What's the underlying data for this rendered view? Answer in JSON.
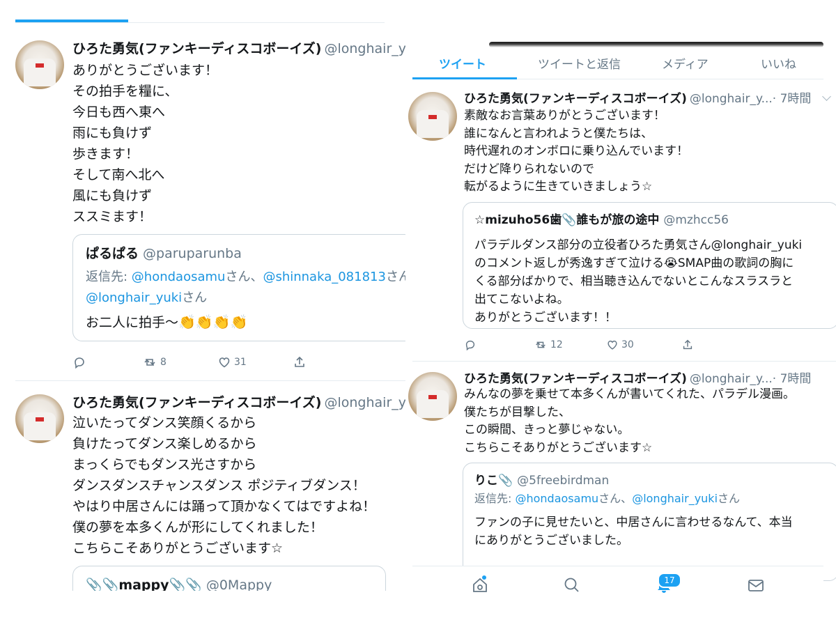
{
  "left": {
    "tweet1": {
      "name": "ひろた勇気(ファンキーディスコボーイズ)",
      "handle": "@longhair_y...",
      "lines": [
        "ありがとうございます！",
        "その拍手を糧に、",
        "今日も西へ東へ",
        "雨にも負けず",
        "歩きます！",
        "そして南へ北へ",
        "風にも負けず",
        "ススミます！"
      ],
      "quote": {
        "name": "ぱるぱる",
        "handle": "@paruparunba",
        "reply_prefix": "返信先: ",
        "reply_mention1": "@hondaosamu",
        "reply_mid1": "さん、",
        "reply_mention2": "@shinnaka_081813",
        "reply_mid2": "さん、",
        "reply_mention3": "@longhair_yuki",
        "reply_suffix": "さん",
        "text": "お二人に拍手〜",
        "claps": "👏👏👏👏"
      },
      "retweets": "8",
      "likes": "31"
    },
    "tweet2": {
      "name": "ひろた勇気(ファンキーディスコボーイズ)",
      "handle": "@longhair_y...",
      "lines": [
        "泣いたってダンス笑顔くるから",
        "負けたってダンス楽しめるから",
        "まっくらでもダンス光さすから",
        "ダンスダンスチャンスダンス ポジティブダンス！",
        "やはり中居さんには踊って頂かなくてはですよね！",
        "僕の夢を本多くんが形にしてくれました！",
        "こちらこそありがとうございます☆"
      ],
      "quote": {
        "name": "📎📎mappy📎📎",
        "handle": "@0Mappy"
      }
    }
  },
  "right": {
    "tabs": [
      "ツイート",
      "ツイートと返信",
      "メディア",
      "いいね"
    ],
    "tweet1": {
      "name": "ひろた勇気(ファンキーディスコボーイズ)",
      "handle": "@longhair_y...",
      "time": "· 7時間",
      "lines": [
        "素敵なお言葉ありがとうございます！",
        "誰になんと言われようと僕たちは、",
        "時代遅れのオンボロに乗り込んでいます！",
        "だけど降りられないので",
        "転がるように生きていきましょう☆"
      ],
      "quote": {
        "name": "☆mizuho56歯📎誰もが旅の途中",
        "handle": "@mzhcc56",
        "lines": [
          "パラデルダンス部分の立役者ひろた勇気さん@longhair_yuki",
          "のコメント返しが秀逸すぎて泣ける😭SMAP曲の歌詞の胸に",
          "くる部分ばかりで、相当聴き込んでないとこんなスラスラと",
          "出てこないよね。",
          "ありがとうございます！！"
        ]
      },
      "retweets": "12",
      "likes": "30"
    },
    "tweet2": {
      "name": "ひろた勇気(ファンキーディスコボーイズ)",
      "handle": "@longhair_y...",
      "time": "· 7時間",
      "lines": [
        "みんなの夢を乗せて本多くんが書いてくれた、パラデル漫画。",
        "僕たちが目撃した、",
        "この瞬間、きっと夢じゃない。",
        "こちらこそありがとうございます☆"
      ],
      "quote": {
        "name": "りこ📎",
        "handle": "@5freebirdman",
        "reply_prefix": "返信先: ",
        "reply_mention1": "@hondaosamu",
        "reply_mid1": "さん、",
        "reply_mention2": "@longhair_yuki",
        "reply_suffix": "さん",
        "lines": [
          "ファンの子に見せたいと、中居さんに言わせるなんて、本当",
          "にありがとうございました。"
        ]
      }
    },
    "notification_count": "17"
  },
  "colors": {
    "accent": "#1da1f2",
    "text": "#14171a",
    "secondary": "#657786",
    "border": "#e6ecf0"
  }
}
